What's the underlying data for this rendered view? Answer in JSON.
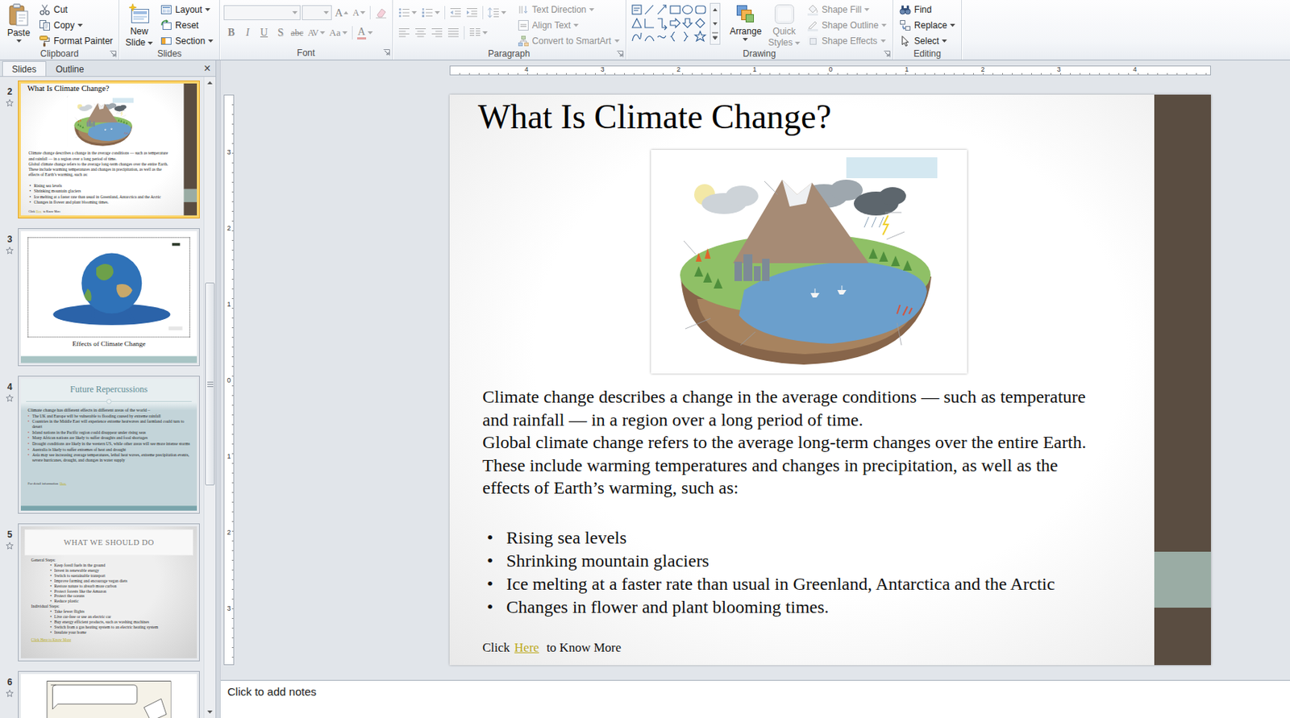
{
  "ribbon": {
    "clipboard": {
      "label": "Clipboard",
      "launcher": true,
      "paste": {
        "label": "Paste",
        "dropdown": true
      },
      "items": [
        {
          "label": "Cut",
          "dropdown": false,
          "disabled": false
        },
        {
          "label": "Copy",
          "dropdown": true,
          "disabled": false
        },
        {
          "label": "Format Painter",
          "dropdown": false,
          "disabled": false
        }
      ]
    },
    "slides": {
      "label": "Slides",
      "launcher": false,
      "new_slide": {
        "lines": [
          "New",
          "Slide"
        ],
        "dropdown": true
      },
      "items": [
        {
          "label": "Layout",
          "dropdown": true,
          "disabled": false
        },
        {
          "label": "Reset",
          "dropdown": false,
          "disabled": false
        },
        {
          "label": "Section",
          "dropdown": true,
          "disabled": false
        }
      ]
    },
    "font": {
      "label": "Font",
      "launcher": true,
      "disabled": true,
      "grow": "A",
      "shrink": "A",
      "styles": [
        {
          "label": "B",
          "dropdown": false
        },
        {
          "label": "I",
          "dropdown": false
        },
        {
          "label": "U",
          "dropdown": false
        },
        {
          "label": "S",
          "dropdown": false
        },
        {
          "label": "abc",
          "dropdown": false
        },
        {
          "label": "AV",
          "dropdown": true
        },
        {
          "label": "Aa",
          "dropdown": true
        }
      ],
      "color": "A"
    },
    "paragraph": {
      "label": "Paragraph",
      "launcher": true,
      "disabled": true,
      "items": [
        {
          "label": "Text Direction",
          "dropdown": true,
          "disabled": true
        },
        {
          "label": "Align Text",
          "dropdown": true,
          "disabled": true
        },
        {
          "label": "Convert to SmartArt",
          "dropdown": true,
          "disabled": true
        }
      ]
    },
    "drawing": {
      "label": "Drawing",
      "launcher": true,
      "arrange": {
        "label": "Arrange",
        "dropdown": true,
        "disabled": false
      },
      "quick_styles": {
        "lines": [
          "Quick",
          "Styles"
        ],
        "dropdown": true,
        "disabled": true
      },
      "items": [
        {
          "label": "Shape Fill",
          "dropdown": true,
          "disabled": true
        },
        {
          "label": "Shape Outline",
          "dropdown": true,
          "disabled": true
        },
        {
          "label": "Shape Effects",
          "dropdown": true,
          "disabled": true
        }
      ]
    },
    "editing": {
      "label": "Editing",
      "launcher": false,
      "items": [
        {
          "label": "Find",
          "dropdown": false,
          "disabled": false
        },
        {
          "label": "Replace",
          "dropdown": true,
          "disabled": false
        },
        {
          "label": "Select",
          "dropdown": true,
          "disabled": false
        }
      ]
    }
  },
  "panel": {
    "tabs": [
      {
        "label": "Slides",
        "selected": true
      },
      {
        "label": "Outline",
        "selected": false
      }
    ],
    "close": "×",
    "slides": [
      {
        "number": "2",
        "selected": true,
        "animated": true,
        "kind": "current"
      },
      {
        "number": "3",
        "selected": false,
        "animated": true,
        "kind": "photo",
        "caption": "Effects of Climate Change"
      },
      {
        "number": "4",
        "selected": false,
        "animated": true,
        "kind": "bullets",
        "title": "Future Repercussions",
        "intro": "Climate change has different effects in different areas of the world –",
        "bullet": "•",
        "bullets": [
          "The UK and Europe will be vulnerable to flooding caused by extreme rainfall",
          "Countries in the Middle East will experience extreme heatwaves and farmland could turn to desert",
          "Island nations in the Pacific region could disappear under rising seas",
          "Many African nations are likely to suffer droughts and food shortages",
          "Drought conditions are likely in the western US, while other areas will see more intense storms",
          "Australia is likely to suffer extremes of heat and drought",
          "Asia may see increasing average temperatures, lethal heat waves, extreme precipitation events, severe hurricanes, drought, and changes in water supply"
        ],
        "footer": "For detail information",
        "link": "Here"
      },
      {
        "number": "5",
        "selected": false,
        "animated": true,
        "kind": "steps",
        "title": "WHAT WE SHOULD DO",
        "bullet": "•",
        "sections": [
          {
            "heading": "General Steps:",
            "items": [
              "Keep fossil fuels in the ground",
              "Invest in renewable energy",
              "Switch to sustainable transport",
              "Improve farming and encourage vegan diets",
              "Restore nature to absorb more carbon",
              "Protect forests like the Amazon",
              "Protect the oceans",
              "Reduce plastic"
            ]
          },
          {
            "heading": "Individual Steps:",
            "items": [
              "Take fewer flights",
              "Live car-free or use an electric car",
              "Buy energy efficient products, such as washing machines",
              "Switch from a gas heating system to an electric heating system",
              "Insulate your home"
            ]
          }
        ],
        "link": "Click Here to Know More"
      },
      {
        "number": "6",
        "selected": false,
        "animated": true,
        "kind": "cartoon"
      }
    ]
  },
  "rulers": {
    "horizontal": [
      "4",
      "3",
      "2",
      "1",
      "0",
      "1",
      "2",
      "3",
      "4"
    ],
    "vertical": [
      "3",
      "2",
      "1",
      "0",
      "1",
      "2",
      "3"
    ]
  },
  "slide": {
    "title": "What Is Climate Change?",
    "lines": [
      "Climate change describes a change in the average conditions — such as temperature",
      "and rainfall — in a region over a long period of time.",
      "Global climate change refers to the average long-term changes over the entire Earth.",
      "These include warming temperatures and changes in precipitation, as well as the",
      "effects of Earth’s warming, such as:"
    ],
    "bullet": "•",
    "bullets": [
      "Rising sea levels",
      "Shrinking mountain glaciers",
      "Ice melting at a faster rate than usual in Greenland, Antarctica and the Arctic",
      "Changes in flower and plant blooming times."
    ],
    "footer": {
      "before": "Click",
      "link": "Here",
      "after": "to Know More"
    }
  },
  "notes": {
    "placeholder": "Click to add notes"
  }
}
